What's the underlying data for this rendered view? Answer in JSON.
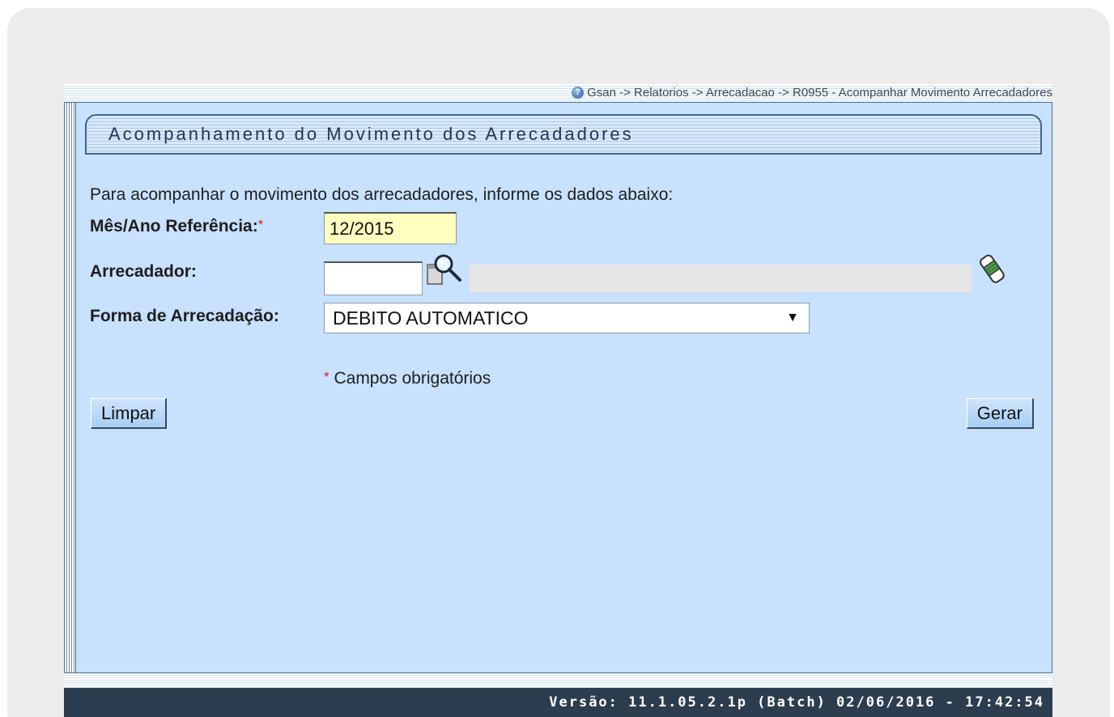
{
  "breadcrumb": {
    "text": "Gsan -> Relatorios -> Arrecadacao -> R0955 - Acompanhar Movimento Arrecadadores"
  },
  "panel": {
    "title": "Acompanhamento do Movimento dos Arrecadadores",
    "intro": "Para acompanhar o movimento dos arrecadadores, informe os dados abaixo:"
  },
  "form": {
    "ref_label": "Mês/Ano Referência:",
    "ref_required": "*",
    "ref_value": "12/2015",
    "arrecadador_label": "Arrecadador:",
    "arrecadador_value": "",
    "arrecadador_desc": "",
    "forma_label": "Forma de Arrecadação:",
    "forma_value": "DEBITO AUTOMATICO",
    "required_star": "*",
    "required_note": "Campos obrigatórios"
  },
  "buttons": {
    "limpar": "Limpar",
    "gerar": "Gerar"
  },
  "footer": {
    "version": "Versão: 11.1.05.2.1p (Batch) 02/06/2016 - 17:42:54"
  },
  "colors": {
    "panel_bg": "#c8e1fd",
    "footer_bg": "#2d3d50",
    "required_input_bg": "#ffffc0",
    "required_star": "#d92020"
  },
  "icons": {
    "help": "help-icon",
    "search": "search-icon",
    "eraser": "eraser-icon"
  }
}
